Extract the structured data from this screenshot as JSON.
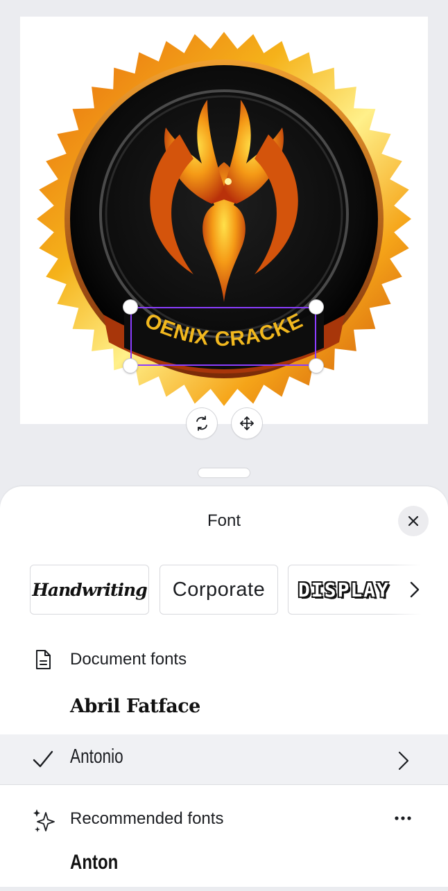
{
  "canvas": {
    "badge_text": "PHOENIX CRACKERS",
    "rotate_icon": "rotate-icon",
    "move_icon": "move-icon",
    "colors": {
      "selection": "#8b3dff",
      "badge_gold": "#f5b21a",
      "badge_orange": "#e8650f",
      "badge_dark": "#0d0d0d"
    }
  },
  "sheet": {
    "title": "Font",
    "close_icon": "close-icon",
    "categories": [
      {
        "label": "Handwriting"
      },
      {
        "label": "Corporate"
      },
      {
        "label": "DISPLAY"
      }
    ],
    "document_fonts": {
      "label": "Document fonts",
      "icon": "document-icon",
      "fonts": [
        {
          "name": "Abril Fatface",
          "selected": false
        },
        {
          "name": "Antonio",
          "selected": true
        }
      ]
    },
    "recommended_fonts": {
      "label": "Recommended fonts",
      "icon": "sparkle-icon",
      "more_icon": "more-options-icon",
      "fonts": [
        {
          "name": "Anton"
        }
      ]
    }
  }
}
